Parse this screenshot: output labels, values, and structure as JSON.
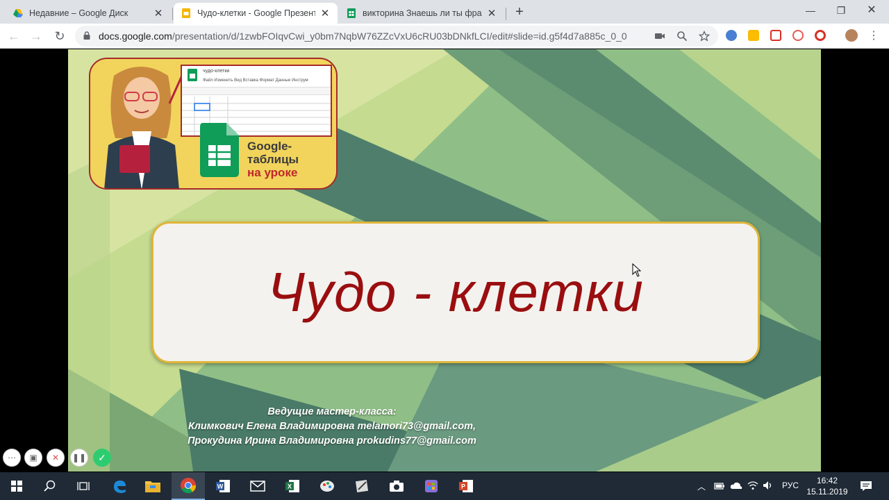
{
  "browser": {
    "tabs": [
      {
        "title": "Недавние – Google Диск",
        "icon": "google-drive-icon"
      },
      {
        "title": "Чудо-клетки - Google Презента",
        "icon": "google-slides-icon"
      },
      {
        "title": "викторина Знаешь ли ты фразе",
        "icon": "google-sheets-icon"
      }
    ],
    "url_domain": "docs.google.com",
    "url_path": "/presentation/d/1zwbFOIqvCwi_y0bm7NqbW76ZZcVxU6cRU03bDNkfLCI/edit#slide=id.g5f4d7a885c_0_0"
  },
  "slide": {
    "thumb": {
      "doc_title": "чудо-клетки",
      "menu": "Файл   Изменить   Вид   Вставка   Формат   Данные   Инструм",
      "logo_line1": "Google-",
      "logo_line2": "таблицы",
      "logo_line3": "на уроке"
    },
    "title": "Чудо - клетки",
    "credits": {
      "line1": "Ведущие мастер-класса:",
      "line2": "Климкович Елена Владимировна melamori73@gmail.com,",
      "line3": "Прокудина Ирина Владимировна prokudins77@gmail.com"
    }
  },
  "taskbar": {
    "language": "РУС",
    "time": "16:42",
    "date": "15.11.2019"
  },
  "colors": {
    "title_red": "#9a0e10",
    "box_border": "#e0b53a",
    "header_yellow": "#f2d45c",
    "sheets_green": "#0f9d58"
  }
}
